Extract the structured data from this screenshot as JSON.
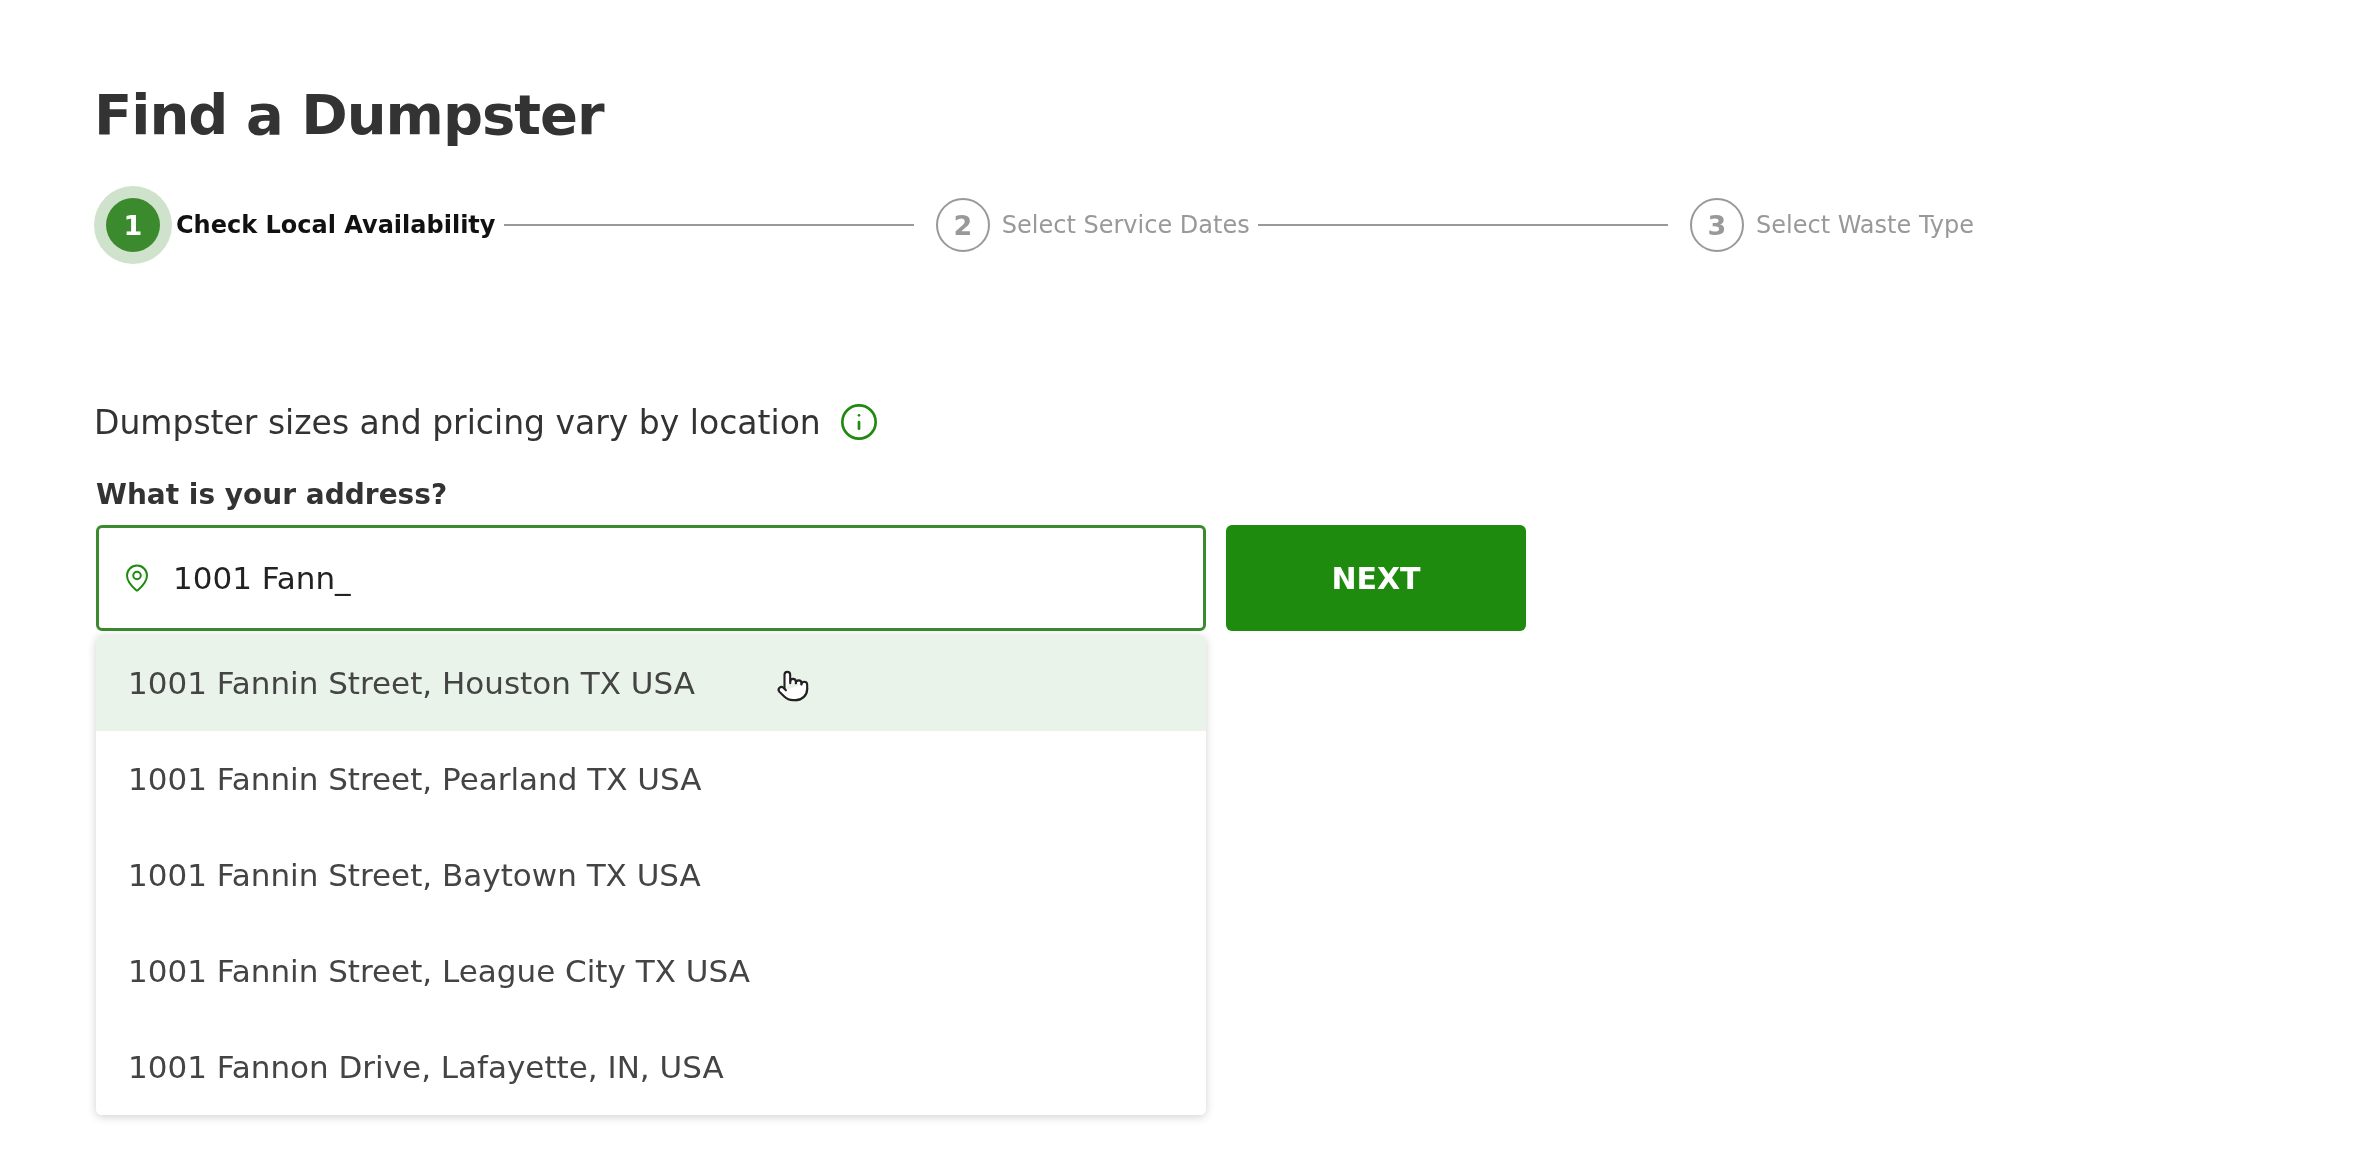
{
  "title": "Find a Dumpster",
  "steps": [
    {
      "number": "1",
      "label": "Check Local Availability",
      "selected": true
    },
    {
      "number": "2",
      "label": "Select Service Dates",
      "selected": false
    },
    {
      "number": "3",
      "label": "Select Waste Type",
      "selected": false
    }
  ],
  "info_text": "Dumpster sizes and pricing vary by location",
  "address_field": {
    "label": "What is your address?",
    "value": "1001 Fann_"
  },
  "next_button": "NEXT",
  "suggestions": [
    {
      "text": "1001 Fannin Street, Houston TX USA",
      "selected": true
    },
    {
      "text": "1001 Fannin Street, Pearland TX USA",
      "selected": false
    },
    {
      "text": "1001 Fannin Street, Baytown TX USA",
      "selected": false
    },
    {
      "text": "1001 Fannin Street, League City TX USA",
      "selected": false
    },
    {
      "text": "1001 Fannon Drive, Lafayette, IN, USA",
      "selected": false
    }
  ]
}
